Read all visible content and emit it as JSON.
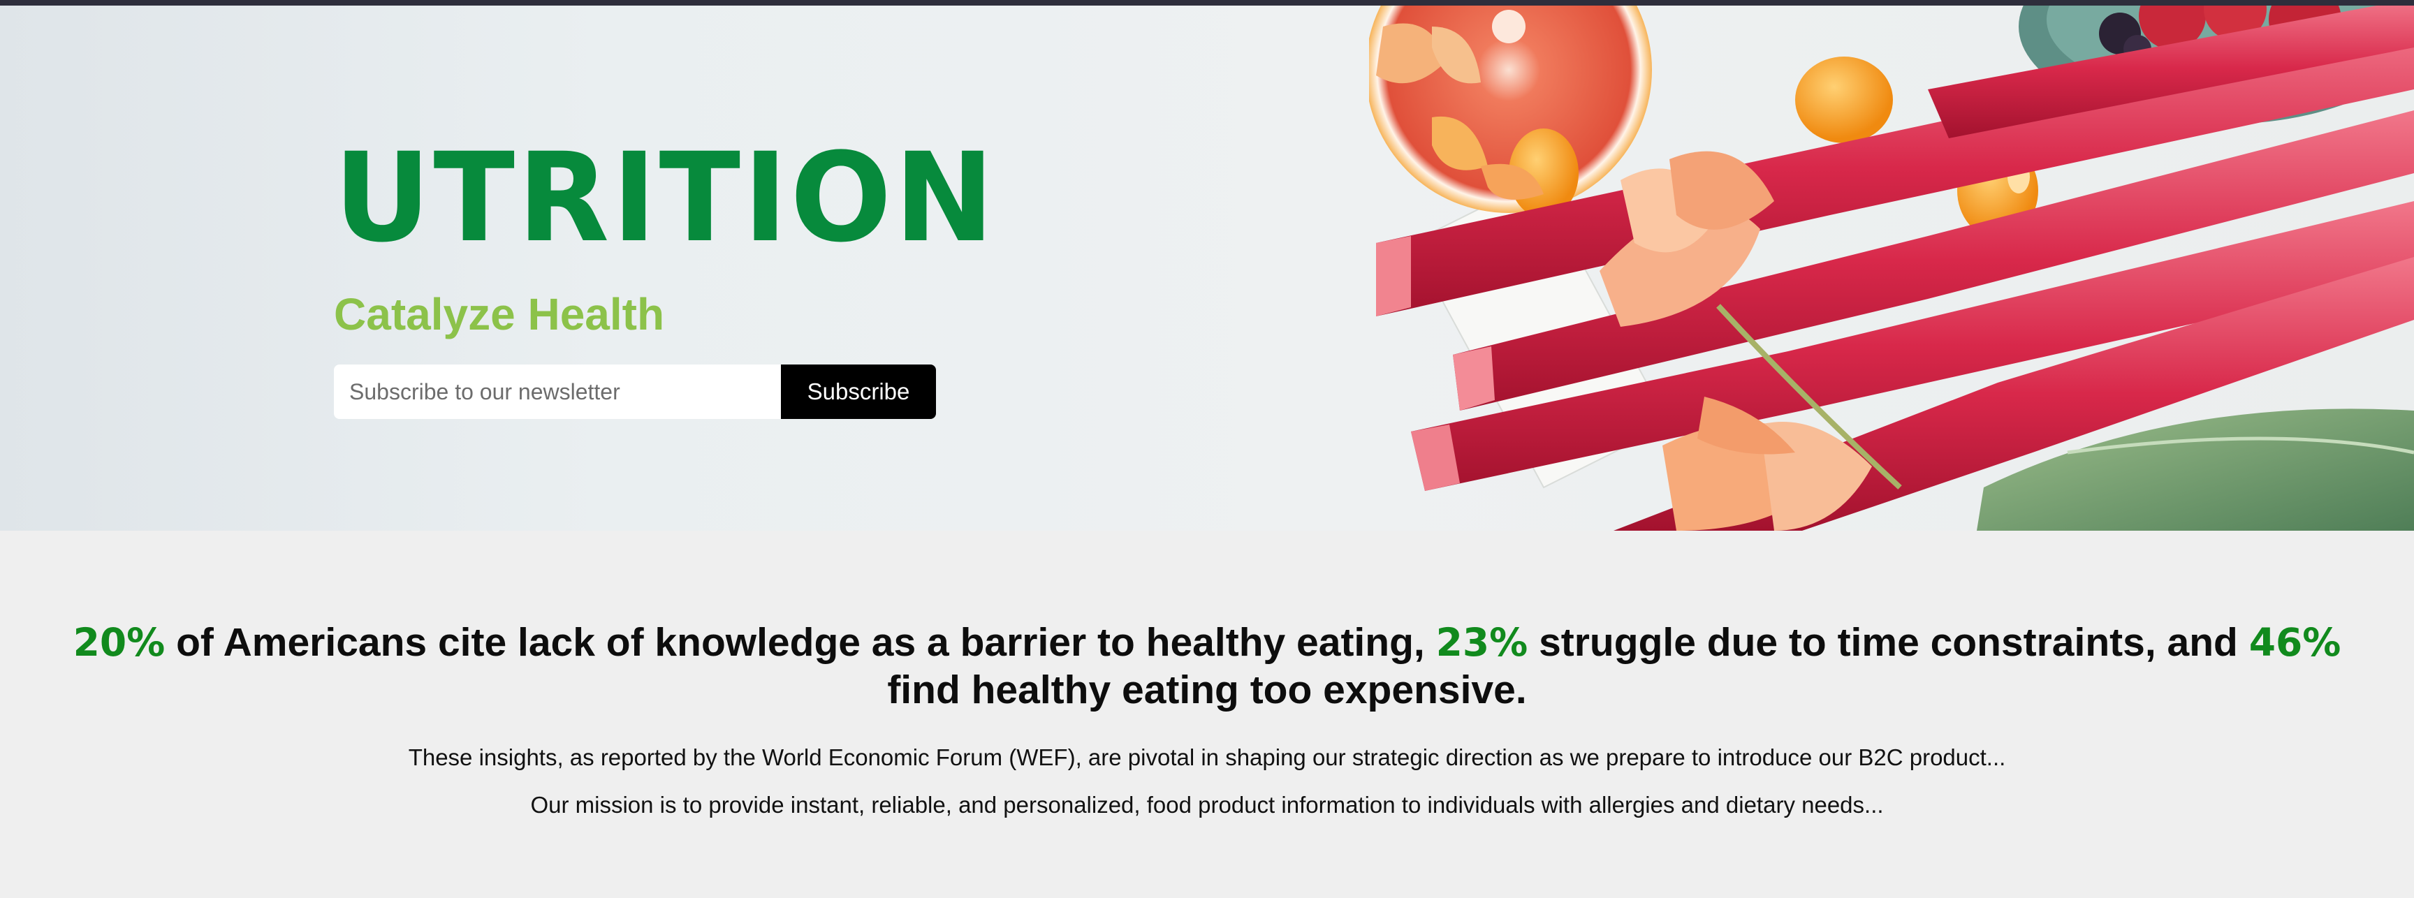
{
  "hero": {
    "title": "UTRITION",
    "tagline": "Catalyze Health",
    "newsletter": {
      "placeholder": "Subscribe to our newsletter",
      "value": "",
      "button_label": "Subscribe"
    }
  },
  "stats": {
    "headline": {
      "stat1": "20%",
      "text1": " of Americans cite lack of knowledge as a barrier to healthy eating, ",
      "stat2": "23%",
      "text2": " struggle due to time constraints, and ",
      "stat3": "46%",
      "text3": " find healthy eating too expensive."
    },
    "paragraph1": "These insights, as reported by the World Economic Forum (WEF), are pivotal in shaping our strategic direction as we prepare to introduce our B2C product...",
    "paragraph2": "Our mission is to provide instant, reliable, and personalized, food product information to individuals with allergies and dietary needs..."
  },
  "colors": {
    "brand_green": "#078a3c",
    "tagline_green": "#8cc24a",
    "stat_green": "#118a1d",
    "button_bg": "#000000"
  }
}
